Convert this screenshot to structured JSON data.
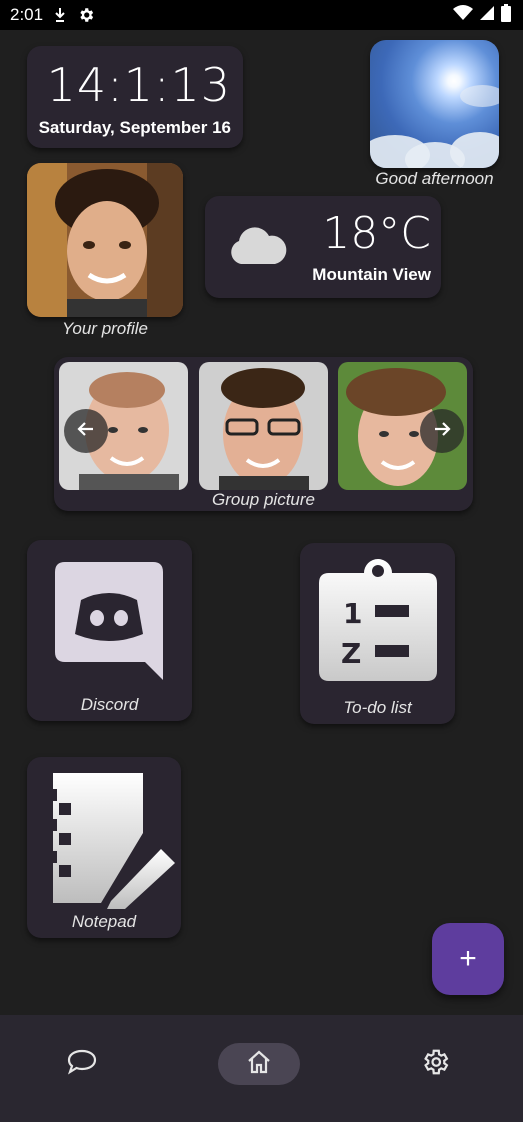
{
  "status_bar": {
    "time": "2:01",
    "left_icons": [
      "download-icon",
      "settings-gear-icon"
    ],
    "right_icons": [
      "wifi-icon",
      "signal-icon",
      "battery-icon"
    ]
  },
  "clock": {
    "time": "14:1:13",
    "date": "Saturday, September 16"
  },
  "greeting_photo": {
    "caption": "Good afternoon"
  },
  "profile": {
    "caption": "Your profile"
  },
  "weather": {
    "temperature": "18°C",
    "location": "Mountain View",
    "icon": "cloud-icon"
  },
  "group_picture": {
    "caption": "Group picture",
    "prev_icon": "arrow-left-icon",
    "next_icon": "arrow-right-icon"
  },
  "apps": [
    {
      "label": "Discord",
      "icon": "discord-icon"
    },
    {
      "label": "To-do list",
      "icon": "todo-list-icon"
    },
    {
      "label": "Notepad",
      "icon": "notepad-icon"
    }
  ],
  "fab": {
    "symbol": "+"
  },
  "bottom_nav": {
    "items": [
      {
        "name": "chat",
        "icon": "chat-icon",
        "selected": false
      },
      {
        "name": "home",
        "icon": "home-icon",
        "selected": true
      },
      {
        "name": "settings",
        "icon": "settings-icon",
        "selected": false
      }
    ]
  },
  "colors": {
    "background": "#1f1f1f",
    "card": "#2a2530",
    "accent": "#5e3d9e",
    "nav_selected": "#4a4553"
  }
}
